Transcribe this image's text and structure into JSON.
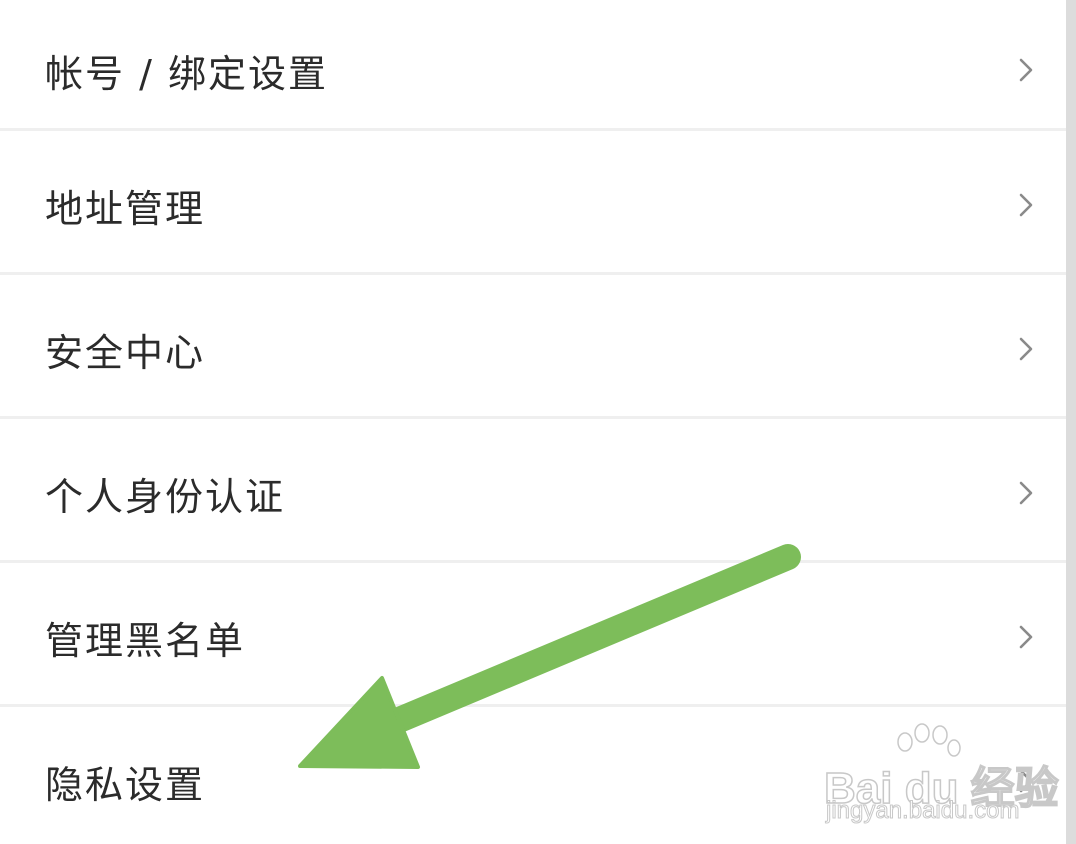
{
  "settings": {
    "items": [
      {
        "label": "帐号 / 绑定设置"
      },
      {
        "label": "地址管理"
      },
      {
        "label": "安全中心"
      },
      {
        "label": "个人身份认证"
      },
      {
        "label": "管理黑名单"
      },
      {
        "label": "隐私设置"
      }
    ]
  },
  "annotation": {
    "arrow_color": "#7dbd5a",
    "points_to": "隐私设置"
  },
  "watermark": {
    "brand": "Bai du 经验",
    "url": "jingyan.baidu.com"
  },
  "colors": {
    "background": "#ffffff",
    "text": "#2b2b2b",
    "divider": "#efefef",
    "chevron": "#8a8a8a"
  }
}
